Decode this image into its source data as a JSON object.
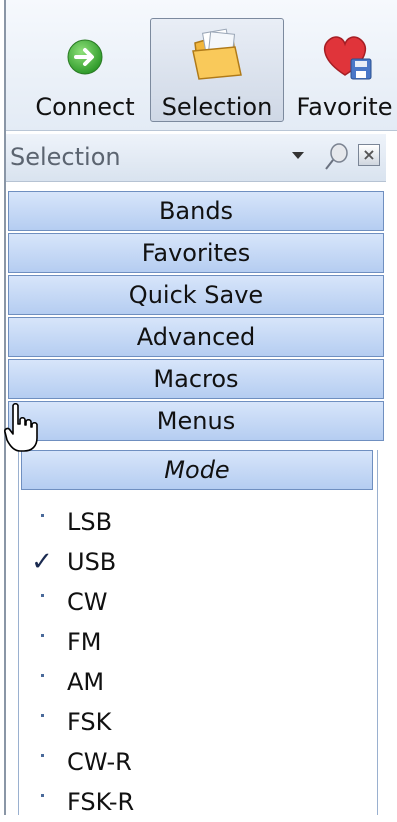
{
  "toolbar": {
    "buttons": [
      {
        "label": "Connect",
        "icon": "connect-arrow-icon",
        "selected": false
      },
      {
        "label": "Selection",
        "icon": "folder-icon",
        "selected": true
      },
      {
        "label": "Favorite",
        "icon": "heart-save-icon",
        "selected": false
      }
    ]
  },
  "pane": {
    "title": "Selection",
    "close_glyph": "×"
  },
  "categories": [
    "Bands",
    "Favorites",
    "Quick Save",
    "Advanced",
    "Macros",
    "Menus"
  ],
  "mode_panel": {
    "header": "Mode",
    "items": [
      {
        "label": "LSB",
        "checked": false
      },
      {
        "label": "USB",
        "checked": true
      },
      {
        "label": "CW",
        "checked": false
      },
      {
        "label": "FM",
        "checked": false
      },
      {
        "label": "AM",
        "checked": false
      },
      {
        "label": "FSK",
        "checked": false
      },
      {
        "label": "CW-R",
        "checked": false
      },
      {
        "label": "FSK-R",
        "checked": false
      }
    ],
    "check_glyph": "✓"
  },
  "colors": {
    "bar_top": "#d7e5fa",
    "bar_bottom": "#b5cdf1",
    "bar_border": "#6f8fc0",
    "connect_green": "#3fae3a",
    "heart_red": "#e0343a"
  }
}
